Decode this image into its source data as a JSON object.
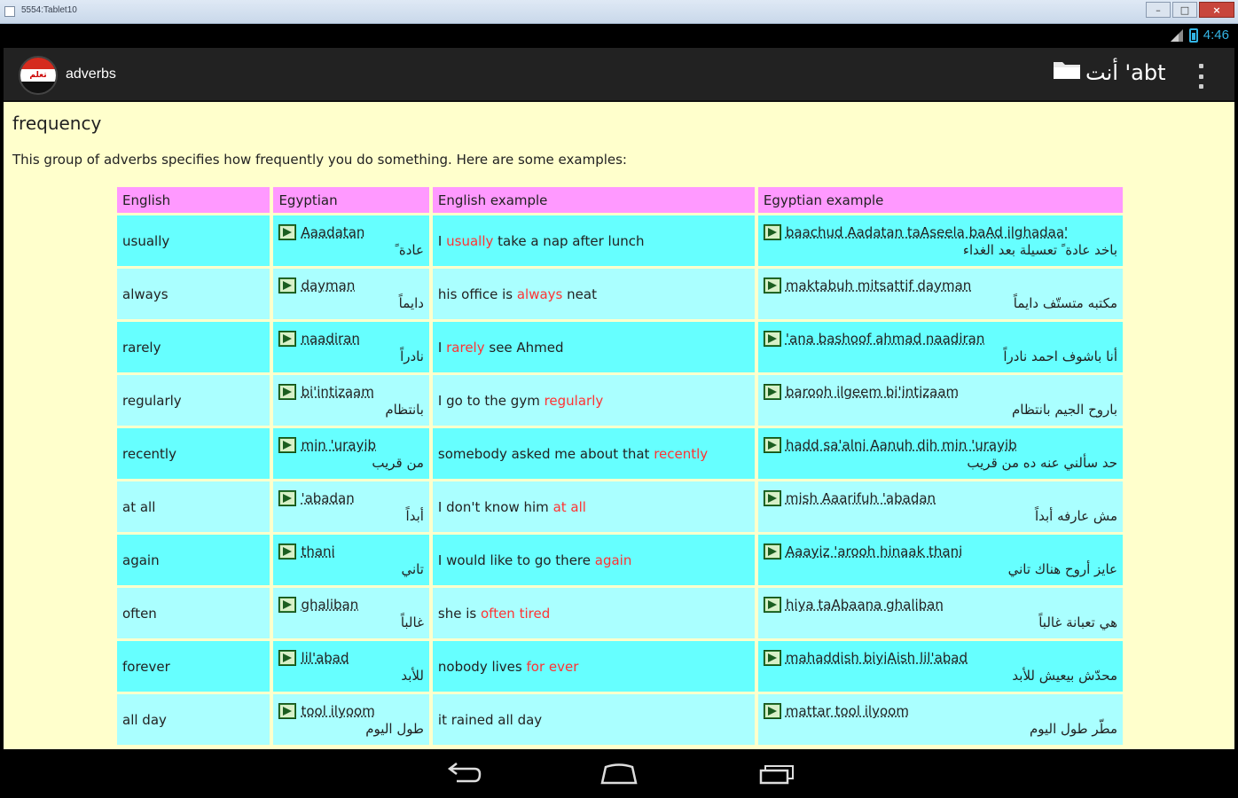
{
  "window": {
    "title": "5554:Tablet10"
  },
  "status_bar": {
    "time": "4:46"
  },
  "action_bar": {
    "app_title": "adverbs",
    "logo_text": "ﺗﻌﻠﻢ",
    "current_title": "ﺃﻧﺖ 'abt"
  },
  "section": {
    "heading": "frequency",
    "description": "This group of adverbs specifies how frequently you do something. Here are some examples:"
  },
  "table": {
    "headers": [
      "English",
      "Egyptian",
      "English example",
      "Egyptian example"
    ],
    "rows": [
      {
        "english": "usually",
        "egyptian_translit": "Aaadatan",
        "egyptian_arabic": "عادة ً",
        "example_before": "I ",
        "example_highlight": "usually",
        "example_after": " take a nap after lunch",
        "egyptian_example_translit": "baachud Aadatan taAseela baAd ilghadaa'",
        "egyptian_example_arabic": "باخد عادة ً تعسيلة بعد الغداء"
      },
      {
        "english": "always",
        "egyptian_translit": "dayman",
        "egyptian_arabic": "دايماً",
        "example_before": "his office is ",
        "example_highlight": "always",
        "example_after": " neat",
        "egyptian_example_translit": "maktabuh mitsattif dayman",
        "egyptian_example_arabic": "مكتبه متستّف دايماً"
      },
      {
        "english": "rarely",
        "egyptian_translit": "naadiran",
        "egyptian_arabic": "نادراً",
        "example_before": "I ",
        "example_highlight": "rarely",
        "example_after": " see Ahmed",
        "egyptian_example_translit": "'ana bashoof ahmad naadiran",
        "egyptian_example_arabic": "أنا باشوف احمد نادراً"
      },
      {
        "english": "regularly",
        "egyptian_translit": "bi'intizaam",
        "egyptian_arabic": "بانتظام",
        "example_before": "I go to the gym ",
        "example_highlight": "regularly",
        "example_after": "",
        "egyptian_example_translit": "barooh ilgeem bi'intizaam",
        "egyptian_example_arabic": "باروح الجيم بانتظام"
      },
      {
        "english": "recently",
        "egyptian_translit": "min 'urayib",
        "egyptian_arabic": "من قريب",
        "example_before": "somebody asked me about that ",
        "example_highlight": "recently",
        "example_after": "",
        "egyptian_example_translit": "hadd sa'alni Aanuh dih min 'urayib",
        "egyptian_example_arabic": "حد سألني عنه ده من قريب"
      },
      {
        "english": "at all",
        "egyptian_translit": "'abadan",
        "egyptian_arabic": "أبداً",
        "example_before": "I don't know him ",
        "example_highlight": "at all",
        "example_after": "",
        "egyptian_example_translit": "mish Aaarifuh 'abadan",
        "egyptian_example_arabic": "مش عارفه أبداً"
      },
      {
        "english": "again",
        "egyptian_translit": "thani",
        "egyptian_arabic": "تاني",
        "example_before": "I would like to go there ",
        "example_highlight": "again",
        "example_after": "",
        "egyptian_example_translit": "Aaayiz 'arooh hinaak thani",
        "egyptian_example_arabic": "عايز أروح هناك تاني"
      },
      {
        "english": "often",
        "egyptian_translit": "ghaliban",
        "egyptian_arabic": "غالباً",
        "example_before": "she is ",
        "example_highlight": "often tired",
        "example_after": "",
        "egyptian_example_translit": "hiya taAbaana ghaliban",
        "egyptian_example_arabic": "هي تعبانة غالباً"
      },
      {
        "english": "forever",
        "egyptian_translit": "lil'abad",
        "egyptian_arabic": "للأبد",
        "example_before": "nobody lives ",
        "example_highlight": "for ever",
        "example_after": "",
        "egyptian_example_translit": "mahaddish biyiAish lil'abad",
        "egyptian_example_arabic": "محدّش بيعيش للأبد"
      },
      {
        "english": "all day",
        "egyptian_translit": "tool ilyoom",
        "egyptian_arabic": "طول اليوم",
        "example_before": "it rained all day",
        "example_highlight": "",
        "example_after": "",
        "egyptian_example_translit": "mattar tool ilyoom",
        "egyptian_example_arabic": "مطّر طول اليوم"
      }
    ]
  },
  "icons": {
    "audio": "audio-play-icon",
    "folder": "folder-icon",
    "overflow": "overflow-menu-icon",
    "back": "back-icon",
    "home": "home-icon",
    "recents": "recent-apps-icon"
  },
  "colors": {
    "content_bg": "#ffffcc",
    "header_bg": "#ff99ff",
    "row_even": "#66ffff",
    "row_odd": "#aaffff",
    "highlight": "#ff3333",
    "status_accent": "#33b5e5"
  }
}
